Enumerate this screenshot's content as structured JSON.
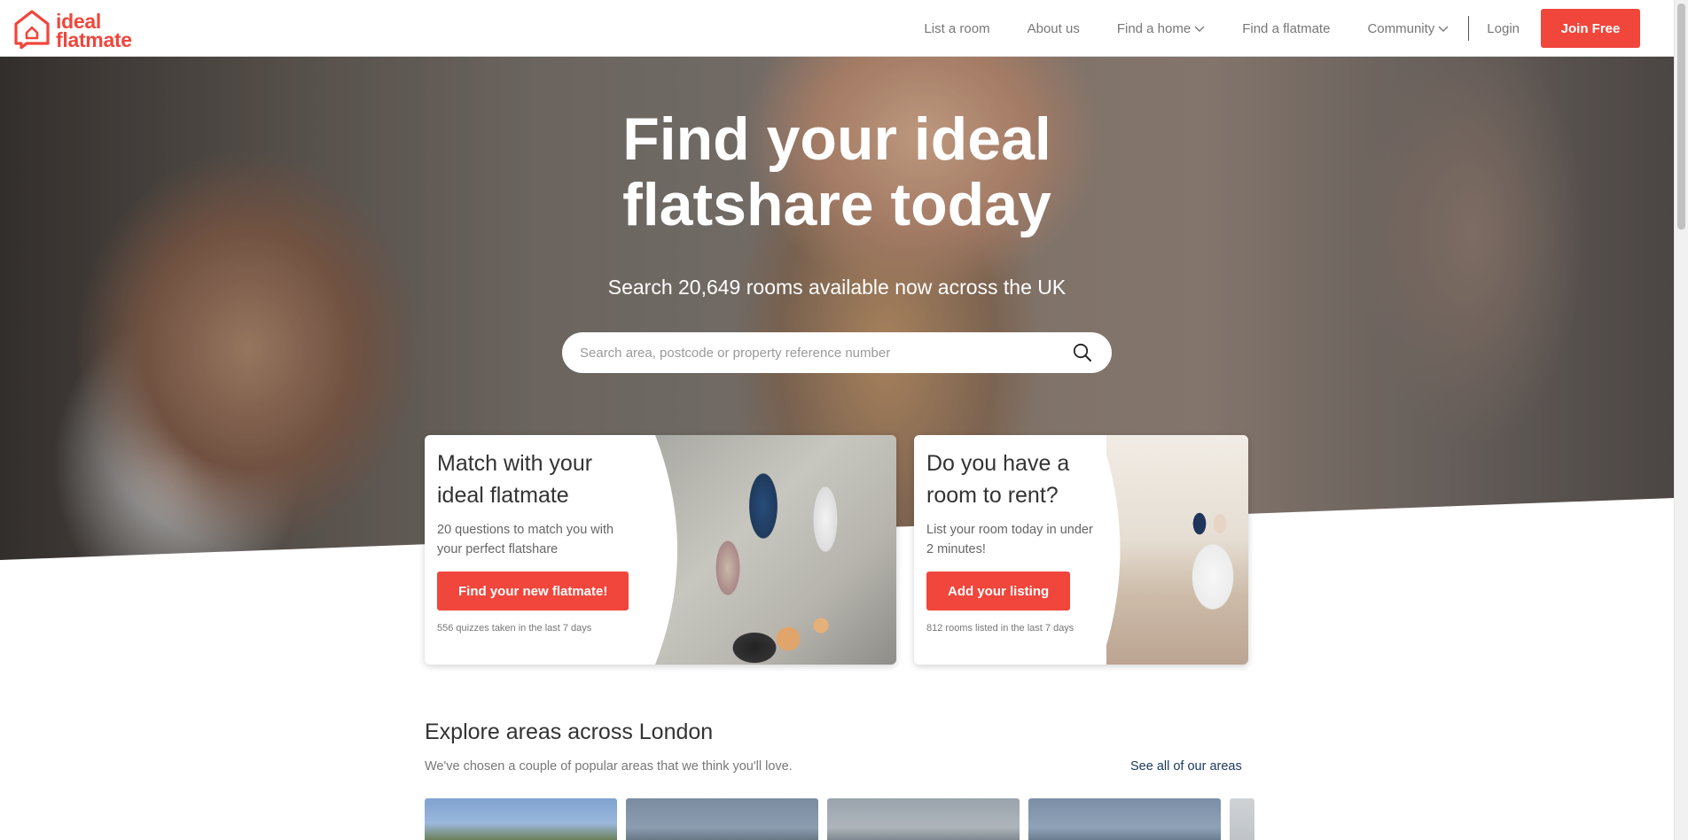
{
  "brand": {
    "line1": "ideal",
    "line2": "flatmate",
    "color": "#f0463c"
  },
  "nav": {
    "list_room": "List a room",
    "about": "About us",
    "find_home": "Find a home",
    "find_flatmate": "Find a flatmate",
    "community": "Community",
    "login": "Login",
    "join": "Join Free"
  },
  "hero": {
    "title_line1": "Find your ideal",
    "title_line2": "flatshare today",
    "subtitle": "Search 20,649 rooms available now across the UK",
    "search_placeholder": "Search area, postcode or property reference number"
  },
  "cards": {
    "match": {
      "title_line1": "Match with your",
      "title_line2": "ideal flatmate",
      "desc_line1": "20 questions to match you with",
      "desc_line2": "your perfect flatshare",
      "button": "Find your new flatmate!",
      "meta": "556 quizzes taken in the last 7 days"
    },
    "rent": {
      "title_line1": "Do you have a",
      "title_line2": "room to rent?",
      "desc_line1": "List your room today in under",
      "desc_line2": "2 minutes!",
      "button": "Add your listing",
      "meta": "812 rooms listed in the last 7 days"
    }
  },
  "explore": {
    "title": "Explore areas across London",
    "subtitle": "We've chosen a couple of popular areas that we think you'll love.",
    "link": "See all of our areas"
  },
  "colors": {
    "accent": "#f0463c",
    "link": "#1e3a60"
  }
}
